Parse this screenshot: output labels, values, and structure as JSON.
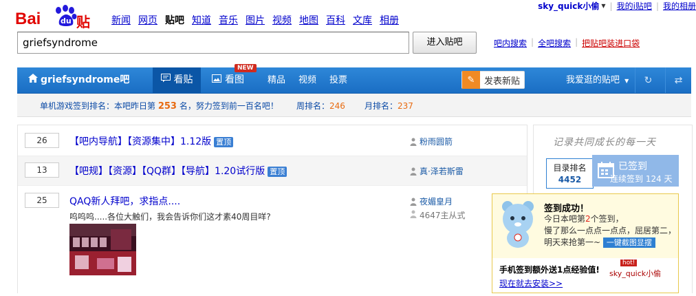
{
  "brand": {
    "logo_text_a": "Bai",
    "logo_text_b": "du",
    "logo_text_c": "贴吧"
  },
  "nav": {
    "items": [
      "新闻",
      "网页",
      "贴吧",
      "知道",
      "音乐",
      "图片",
      "视频",
      "地图",
      "百科",
      "文库",
      "相册"
    ],
    "active": "贴吧"
  },
  "userbar": {
    "username": "sky_quick小偷",
    "links": [
      "我的i贴吧",
      "我的相册"
    ]
  },
  "search": {
    "value": "griefsyndrome",
    "button": "进入贴吧",
    "links": [
      "吧内搜索",
      "全吧搜索"
    ],
    "red_link": "把贴吧装进口袋"
  },
  "bar": {
    "forum_name": "griefsyndrome吧",
    "tab_kantie": "看贴",
    "tab_kantu": "看图",
    "new_badge": "NEW",
    "subtabs": [
      "精品",
      "视频",
      "投票"
    ],
    "post_button": "发表新贴",
    "fav": "我爱逛的贴吧"
  },
  "rank": {
    "prefix": "单机游戏签到排名：本吧昨日第",
    "rank_num": "253",
    "suffix": "名，努力签到前一百名吧！",
    "week_label": "周排名：",
    "week_num": "246",
    "month_label": "月排名：",
    "month_num": "237"
  },
  "threads": [
    {
      "replies": "26",
      "title": "【吧内导航】【资源集中】1.12版",
      "pin": "置顶",
      "author": "粉雨圆箭"
    },
    {
      "replies": "13",
      "title": "【吧规】【资源】【QQ群】【导航】1.20试行版",
      "pin": "置顶",
      "author": "真·泽若斯雷"
    },
    {
      "replies": "25",
      "title": "QAQ新人拜吧，求指点....",
      "author": "夜媚皇月",
      "excerpt": "呜呜呜.....各位大触们，我会告诉你们这才素40周目咩?",
      "last_reply": "4647主从式"
    }
  ],
  "sidebar": {
    "slogan": "记录共同成长的每一天",
    "mulu_label": "目录排名",
    "mulu_num": "4452",
    "signed": "已签到",
    "signed_days": "连续签到 124 天"
  },
  "popup": {
    "title": "签到成功！",
    "line1_a": "今日本吧第",
    "line1_num": "2",
    "line1_b": "个签到，",
    "line2": "慢了那么一点点一点点，屈居第二，",
    "line3": "明天来抢第一~",
    "button": "一键截图显摆"
  },
  "banner": {
    "text": "手机签到额外送1点经验值!",
    "link": "现在就去安装>>",
    "hot": "hot!",
    "deco": "sky_quick小偷"
  },
  "colors": {
    "bar_blue": "#1a6ec4",
    "accent_orange": "#e86a10",
    "link_blue": "#0000cc",
    "pin_blue": "#3a7fd3"
  }
}
